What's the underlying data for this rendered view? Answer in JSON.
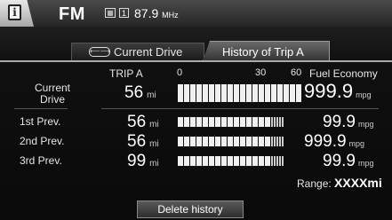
{
  "topbar": {
    "band": "FM",
    "preset": "1",
    "frequency": "87.9",
    "frequency_unit": "MHz"
  },
  "tabs": [
    {
      "label": "Current Drive",
      "active": false
    },
    {
      "label": "History of Trip A",
      "active": true
    }
  ],
  "headers": {
    "trip": "TRIP A",
    "scale_0": "0",
    "scale_30": "30",
    "scale_60": "60",
    "fuel_economy": "Fuel Economy"
  },
  "rows": [
    {
      "label": "Current Drive",
      "trip": "56",
      "trip_unit": "mi",
      "economy": "999.9",
      "economy_unit": "mpg",
      "bar_fraction": 1.0
    },
    {
      "label": "1st Prev.",
      "trip": "56",
      "trip_unit": "mi",
      "economy": "99.9",
      "economy_unit": "mpg",
      "bar_fraction": 1.0
    },
    {
      "label": "2nd Prev.",
      "trip": "56",
      "trip_unit": "mi",
      "economy": "999.9",
      "economy_unit": "mpg",
      "bar_fraction": 1.0
    },
    {
      "label": "3rd Prev.",
      "trip": "99",
      "trip_unit": "mi",
      "economy": "99.9",
      "economy_unit": "mpg",
      "bar_fraction": 1.0
    }
  ],
  "range": {
    "label": "Range:",
    "value": "XXXXmi"
  },
  "delete_button": "Delete history"
}
